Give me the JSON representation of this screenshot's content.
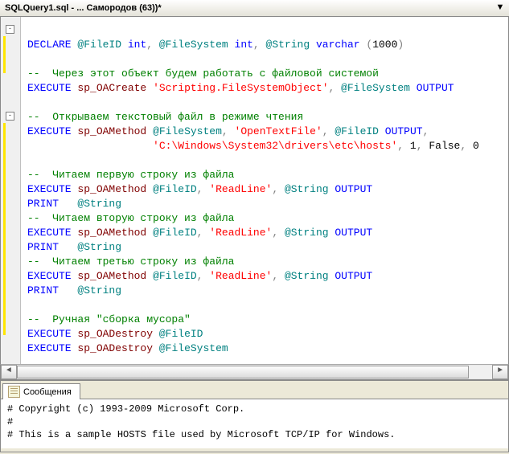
{
  "tab_title": "SQLQuery1.sql - ... Самородов (63))*",
  "code": {
    "l1": {
      "kw": "DECLARE",
      "v1": "@FileID",
      "t1": "int",
      "v2": "@FileSystem",
      "t2": "int",
      "v3": "@String",
      "t3": "varchar",
      "paren_open": "(",
      "n": "1000",
      "paren_close": ")"
    },
    "l3": {
      "cmt": "--  Через этот объект будем работать с файловой системой"
    },
    "l4": {
      "kw": "EXECUTE",
      "sp": "sp_OACreate",
      "s": "'Scripting.FileSystemObject'",
      "v": "@FileSystem",
      "out": "OUTPUT"
    },
    "l6": {
      "cmt": "--  Открываем текстовый файл в режиме чтения"
    },
    "l7": {
      "kw": "EXECUTE",
      "sp": "sp_OAMethod",
      "v1": "@FileSystem",
      "s": "'OpenTextFile'",
      "v2": "@FileID",
      "out": "OUTPUT"
    },
    "l8": {
      "s": "'C:\\Windows\\System32\\drivers\\etc\\hosts'",
      "n1": "1",
      "b": "False",
      "n2": "0"
    },
    "l10": {
      "cmt": "--  Читаем первую строку из файла"
    },
    "l11": {
      "kw": "EXECUTE",
      "sp": "sp_OAMethod",
      "v1": "@FileID",
      "s": "'ReadLine'",
      "v2": "@String",
      "out": "OUTPUT"
    },
    "l12": {
      "kw": "PRINT",
      "v": "@String"
    },
    "l13": {
      "cmt": "--  Читаем вторую строку из файла"
    },
    "l14": {
      "kw": "EXECUTE",
      "sp": "sp_OAMethod",
      "v1": "@FileID",
      "s": "'ReadLine'",
      "v2": "@String",
      "out": "OUTPUT"
    },
    "l15": {
      "kw": "PRINT",
      "v": "@String"
    },
    "l16": {
      "cmt": "--  Читаем третью строку из файла"
    },
    "l17": {
      "kw": "EXECUTE",
      "sp": "sp_OAMethod",
      "v1": "@FileID",
      "s": "'ReadLine'",
      "v2": "@String",
      "out": "OUTPUT"
    },
    "l18": {
      "kw": "PRINT",
      "v": "@String"
    },
    "l20": {
      "cmt": "--  Ручная \"сборка мусора\""
    },
    "l21": {
      "kw": "EXECUTE",
      "sp": "sp_OADestroy",
      "v": "@FileID"
    },
    "l22": {
      "kw": "EXECUTE",
      "sp": "sp_OADestroy",
      "v": "@FileSystem"
    }
  },
  "messages_tab": "Сообщения",
  "messages": {
    "m1": "# Copyright (c) 1993-2009 Microsoft Corp.",
    "m2": "#",
    "m3": "# This is a sample HOSTS file used by Microsoft TCP/IP for Windows."
  }
}
